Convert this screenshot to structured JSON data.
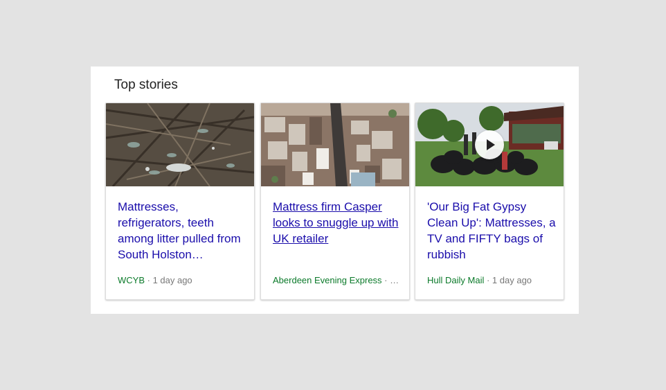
{
  "top_stories": {
    "heading": "Top stories",
    "cards": [
      {
        "title": "Mattresses, refrigerators, teeth among litter pulled from South Holston…",
        "source": "WCYB",
        "separator": " · ",
        "age": "1 day ago",
        "image": "river-litter-photo",
        "has_video": false
      },
      {
        "title": "Mattress firm Casper looks to snuggle up with UK retailer",
        "source": "Aberdeen Evening Express",
        "separator": " · ",
        "age": "…",
        "image": "aerial-city-photo",
        "has_video": false
      },
      {
        "title": "'Our Big Fat Gypsy Clean Up': Mattresses, a TV and FIFTY bags of rubbish",
        "source": "Hull Daily Mail",
        "separator": " · ",
        "age": "1 day ago",
        "image": "rubbish-bags-park-photo",
        "has_video": true,
        "video_icon": "play-icon"
      }
    ]
  },
  "colors": {
    "background": "#e3e3e3",
    "panel": "#ffffff",
    "link": "#1a0dab",
    "source": "#0b7a2a",
    "meta": "#777777"
  }
}
